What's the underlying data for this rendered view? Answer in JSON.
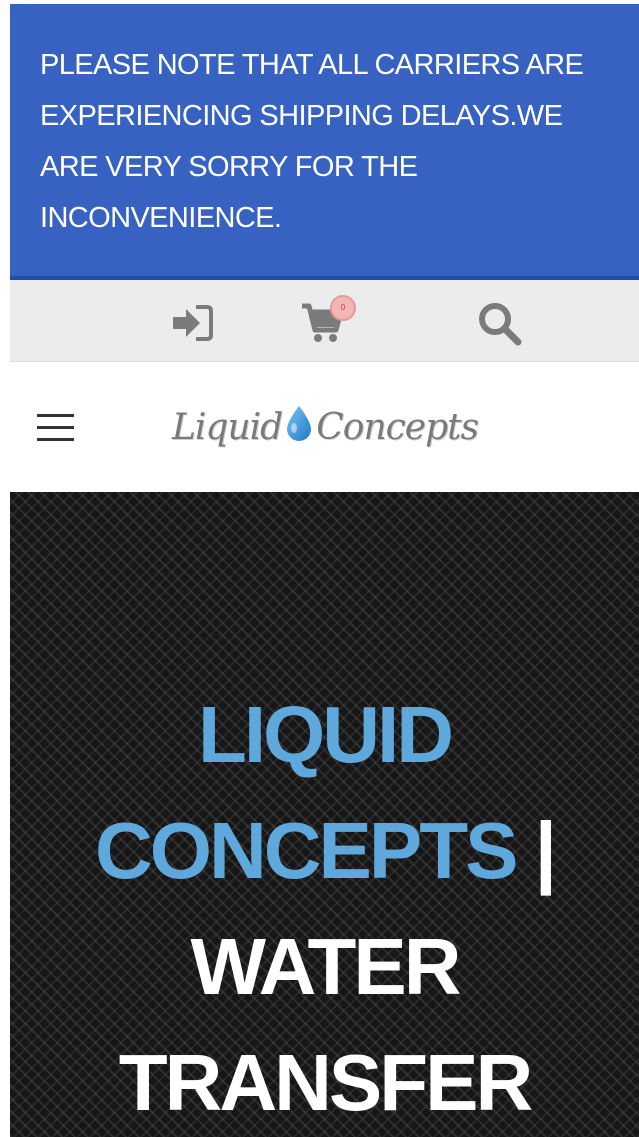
{
  "notice": {
    "text": "PLEASE NOTE THAT ALL CARRIERS ARE EXPERIENCING SHIPPING DELAYS.WE ARE VERY SORRY FOR THE INCONVENIENCE.",
    "background": "#3762c2"
  },
  "utility_bar": {
    "login_icon": "sign-in-icon",
    "cart_icon": "shopping-cart-icon",
    "cart_count": "0",
    "search_icon": "search-icon"
  },
  "header": {
    "menu_icon": "hamburger-menu-icon",
    "logo": {
      "word1": "Liquid",
      "word2": "Concepts",
      "drop_color": "#2a8fd6"
    }
  },
  "hero": {
    "title_part1": "LIQUID CONCEPTS",
    "title_part2": "|",
    "title_part3": "WATER TRANSFER",
    "accent_color": "#5fa8dc"
  }
}
